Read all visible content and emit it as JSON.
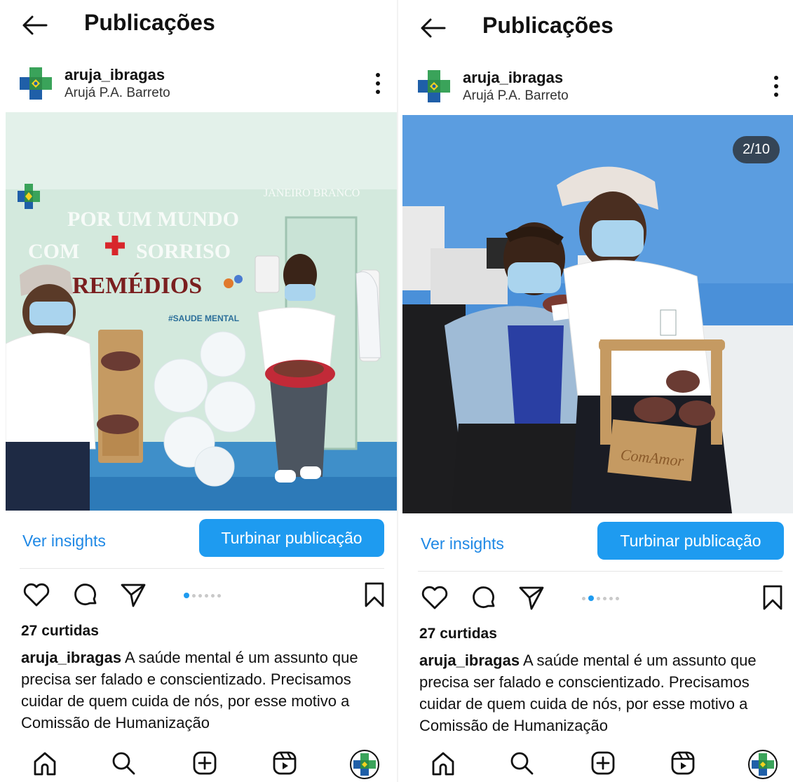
{
  "screens": [
    {
      "header": {
        "title": "Publicações"
      },
      "post": {
        "username": "aruja_ibragas",
        "location": "Arujá P.A. Barreto",
        "counter": "",
        "carousel": {
          "total": 6,
          "active": 0
        }
      },
      "buttons": {
        "insights": "Ver insights",
        "boost": "Turbinar publicação"
      },
      "likes": "27 curtidas",
      "caption": {
        "user": "aruja_ibragas",
        "text": " A saúde mental é um assunto que precisa ser falado e conscientizado. Precisamos cuidar de quem cuida de nós, por esse motivo a Comissão de Humanização"
      },
      "image_text": {
        "line1": "POR UM MUNDO",
        "line2": "COM",
        "line2b": "SORRISO",
        "line3": "REMÉDIOS",
        "hashtag": "#SAUDE MENTAL",
        "door": "JANEIRO BRANCO"
      }
    },
    {
      "header": {
        "title": "Publicações"
      },
      "post": {
        "username": "aruja_ibragas",
        "location": "Arujá P.A. Barreto",
        "counter": "2/10",
        "carousel": {
          "total": 6,
          "active": 1
        }
      },
      "buttons": {
        "insights": "Ver insights",
        "boost": "Turbinar publicação"
      },
      "likes": "27 curtidas",
      "caption": {
        "user": "aruja_ibragas",
        "text": " A saúde mental é um assunto que precisa ser falado e conscientizado. Precisamos cuidar de quem cuida de nós, por esse motivo a Comissão de Humanização"
      },
      "image_text": {
        "basket": "ComAmor"
      }
    }
  ],
  "icons": {
    "back": "arrow-left-icon",
    "more": "more-vertical-icon",
    "like": "heart-icon",
    "comment": "comment-icon",
    "share": "send-icon",
    "save": "bookmark-icon",
    "nav": [
      "home-icon",
      "search-icon",
      "add-post-icon",
      "reels-icon",
      "profile-avatar-icon"
    ]
  },
  "colors": {
    "accent": "#1e9bf0",
    "link": "#1e88e5",
    "wall_left": "#cfe8dc",
    "wall_right": "#4a90d9"
  }
}
